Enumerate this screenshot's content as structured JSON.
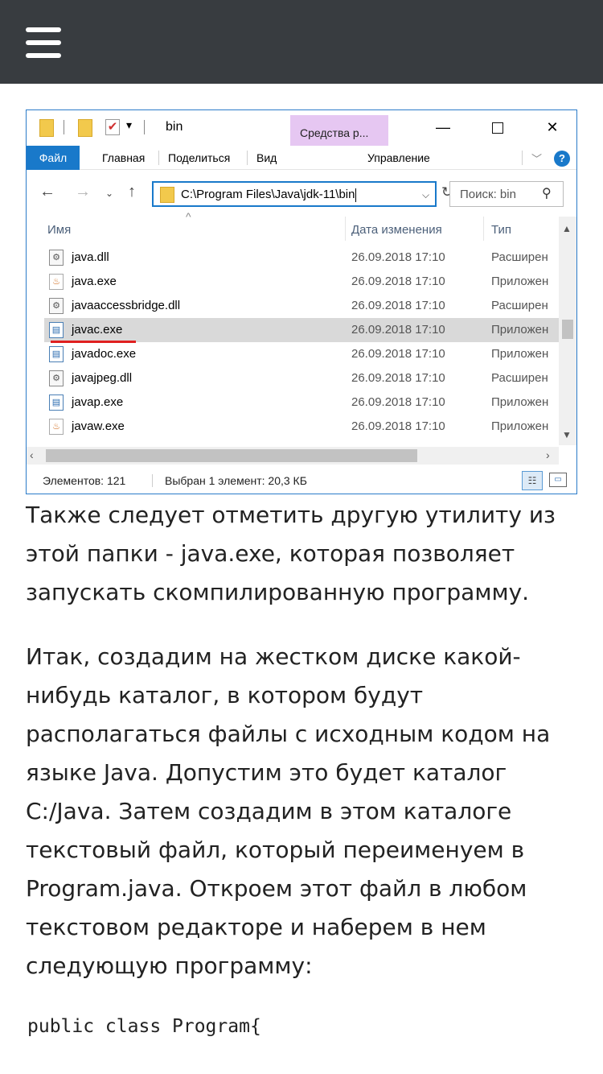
{
  "nav": {
    "menu_icon": "hamburger-menu-icon"
  },
  "explorer": {
    "window_title": "bin",
    "contextual_tab": "Средства р...",
    "window_buttons": {
      "minimize": "—",
      "maximize": "☐",
      "close": "✕"
    },
    "ribbon": {
      "tabs": [
        "Файл",
        "Главная",
        "Поделиться",
        "Вид"
      ],
      "manage_tab": "Управление",
      "help": "?"
    },
    "address": {
      "path": "C:\\Program Files\\Java\\jdk-11\\bin",
      "search_placeholder": "Поиск: bin"
    },
    "columns": {
      "name": "Имя",
      "date": "Дата изменения",
      "type": "Тип"
    },
    "files": [
      {
        "name": "java.dll",
        "date": "26.09.2018 17:10",
        "type": "Расширен",
        "icon": "dll-file-icon",
        "selected": false
      },
      {
        "name": "java.exe",
        "date": "26.09.2018 17:10",
        "type": "Приложен",
        "icon": "java-exe-icon",
        "selected": false
      },
      {
        "name": "javaaccessbridge.dll",
        "date": "26.09.2018 17:10",
        "type": "Расширен",
        "icon": "dll-file-icon",
        "selected": false
      },
      {
        "name": "javac.exe",
        "date": "26.09.2018 17:10",
        "type": "Приложен",
        "icon": "exe-file-icon",
        "selected": true
      },
      {
        "name": "javadoc.exe",
        "date": "26.09.2018 17:10",
        "type": "Приложен",
        "icon": "exe-file-icon",
        "selected": false
      },
      {
        "name": "javajpeg.dll",
        "date": "26.09.2018 17:10",
        "type": "Расширен",
        "icon": "dll-file-icon",
        "selected": false
      },
      {
        "name": "javap.exe",
        "date": "26.09.2018 17:10",
        "type": "Приложен",
        "icon": "exe-file-icon",
        "selected": false
      },
      {
        "name": "javaw.exe",
        "date": "26.09.2018 17:10",
        "type": "Приложен",
        "icon": "java-exe-icon",
        "selected": false
      }
    ],
    "status": {
      "count": "Элементов: 121",
      "selection": "Выбран 1 элемент: 20,3 КБ"
    }
  },
  "article": {
    "paragraph1": "Также следует отметить другую утилиту из этой папки - java.exe, которая позволяет запускать скомпилированную программу.",
    "paragraph2": "Итак, создадим на жестком диске какой-нибудь каталог, в котором будут располагаться файлы с исходным кодом на языке Java. Допустим это будет каталог C:/Java. Затем создадим в этом каталоге текстовый файл, который переименуем в Program.java. Откроем этот файл в любом текстовом редакторе и наберем в нем следующую программу:",
    "code_line": "public class Program{"
  }
}
